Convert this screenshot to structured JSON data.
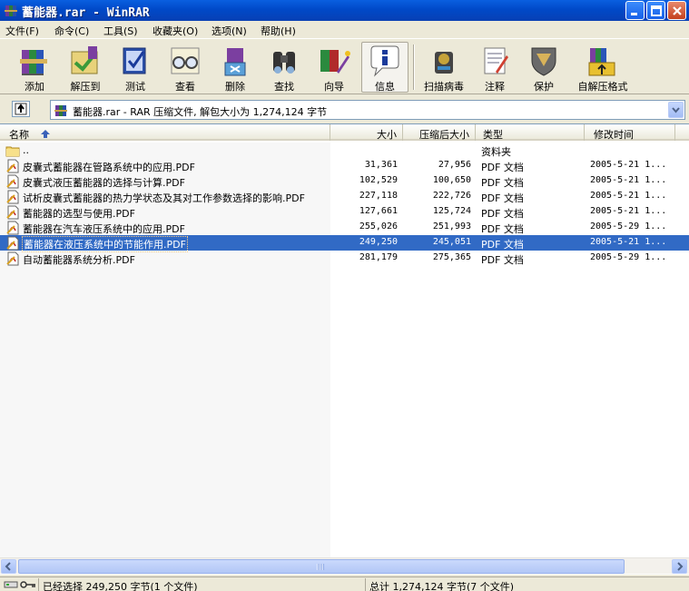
{
  "window": {
    "title": "蓄能器.rar - WinRAR"
  },
  "menu": [
    {
      "label": "文件(F)"
    },
    {
      "label": "命令(C)"
    },
    {
      "label": "工具(S)"
    },
    {
      "label": "收藏夹(O)"
    },
    {
      "label": "选项(N)"
    },
    {
      "label": "帮助(H)"
    }
  ],
  "toolbar": [
    {
      "label": "添加",
      "icon": "add-books-icon"
    },
    {
      "label": "解压到",
      "icon": "extract-to-icon"
    },
    {
      "label": "测试",
      "icon": "test-icon"
    },
    {
      "label": "查看",
      "icon": "view-glasses-icon"
    },
    {
      "label": "删除",
      "icon": "delete-icon"
    },
    {
      "label": "查找",
      "icon": "find-binoculars-icon"
    },
    {
      "label": "向导",
      "icon": "wizard-icon"
    },
    {
      "label": "信息",
      "icon": "info-icon"
    },
    {
      "label": "扫描病毒",
      "icon": "virus-scan-icon"
    },
    {
      "label": "注释",
      "icon": "comment-icon"
    },
    {
      "label": "保护",
      "icon": "protect-shield-icon"
    },
    {
      "label": "自解压格式",
      "icon": "sfx-icon"
    }
  ],
  "address": {
    "text": "蓄能器.rar - RAR 压缩文件, 解包大小为 1,274,124 字节"
  },
  "columns": {
    "name": "名称",
    "size": "大小",
    "packed": "压缩后大小",
    "type": "类型",
    "modified": "修改时间"
  },
  "files": [
    {
      "name": "..",
      "size": "",
      "packed": "",
      "type": "资料夹",
      "modified": "",
      "kind": "folder"
    },
    {
      "name": "皮囊式蓄能器在管路系统中的应用.PDF",
      "size": "31,361",
      "packed": "27,956",
      "type": "PDF 文档",
      "modified": "2005-5-21 1...",
      "kind": "pdf"
    },
    {
      "name": "皮囊式液压蓄能器的选择与计算.PDF",
      "size": "102,529",
      "packed": "100,650",
      "type": "PDF 文档",
      "modified": "2005-5-21 1...",
      "kind": "pdf"
    },
    {
      "name": "试析皮囊式蓄能器的热力学状态及其对工作参数选择的影响.PDF",
      "size": "227,118",
      "packed": "222,726",
      "type": "PDF 文档",
      "modified": "2005-5-21 1...",
      "kind": "pdf"
    },
    {
      "name": "蓄能器的选型与使用.PDF",
      "size": "127,661",
      "packed": "125,724",
      "type": "PDF 文档",
      "modified": "2005-5-21 1...",
      "kind": "pdf"
    },
    {
      "name": "蓄能器在汽车液压系统中的应用.PDF",
      "size": "255,026",
      "packed": "251,993",
      "type": "PDF 文档",
      "modified": "2005-5-29 1...",
      "kind": "pdf"
    },
    {
      "name": "蓄能器在液压系统中的节能作用.PDF",
      "size": "249,250",
      "packed": "245,051",
      "type": "PDF 文档",
      "modified": "2005-5-21 1...",
      "kind": "pdf",
      "selected": true
    },
    {
      "name": "自动蓄能器系统分析.PDF",
      "size": "281,179",
      "packed": "275,365",
      "type": "PDF 文档",
      "modified": "2005-5-29 1...",
      "kind": "pdf"
    }
  ],
  "status": {
    "left": "已经选择 249,250 字节(1 个文件)",
    "right": "总计 1,274,124 字节(7 个文件)"
  },
  "colors": {
    "selection": "#316ac5",
    "titlebar": "#0a5fe0"
  }
}
